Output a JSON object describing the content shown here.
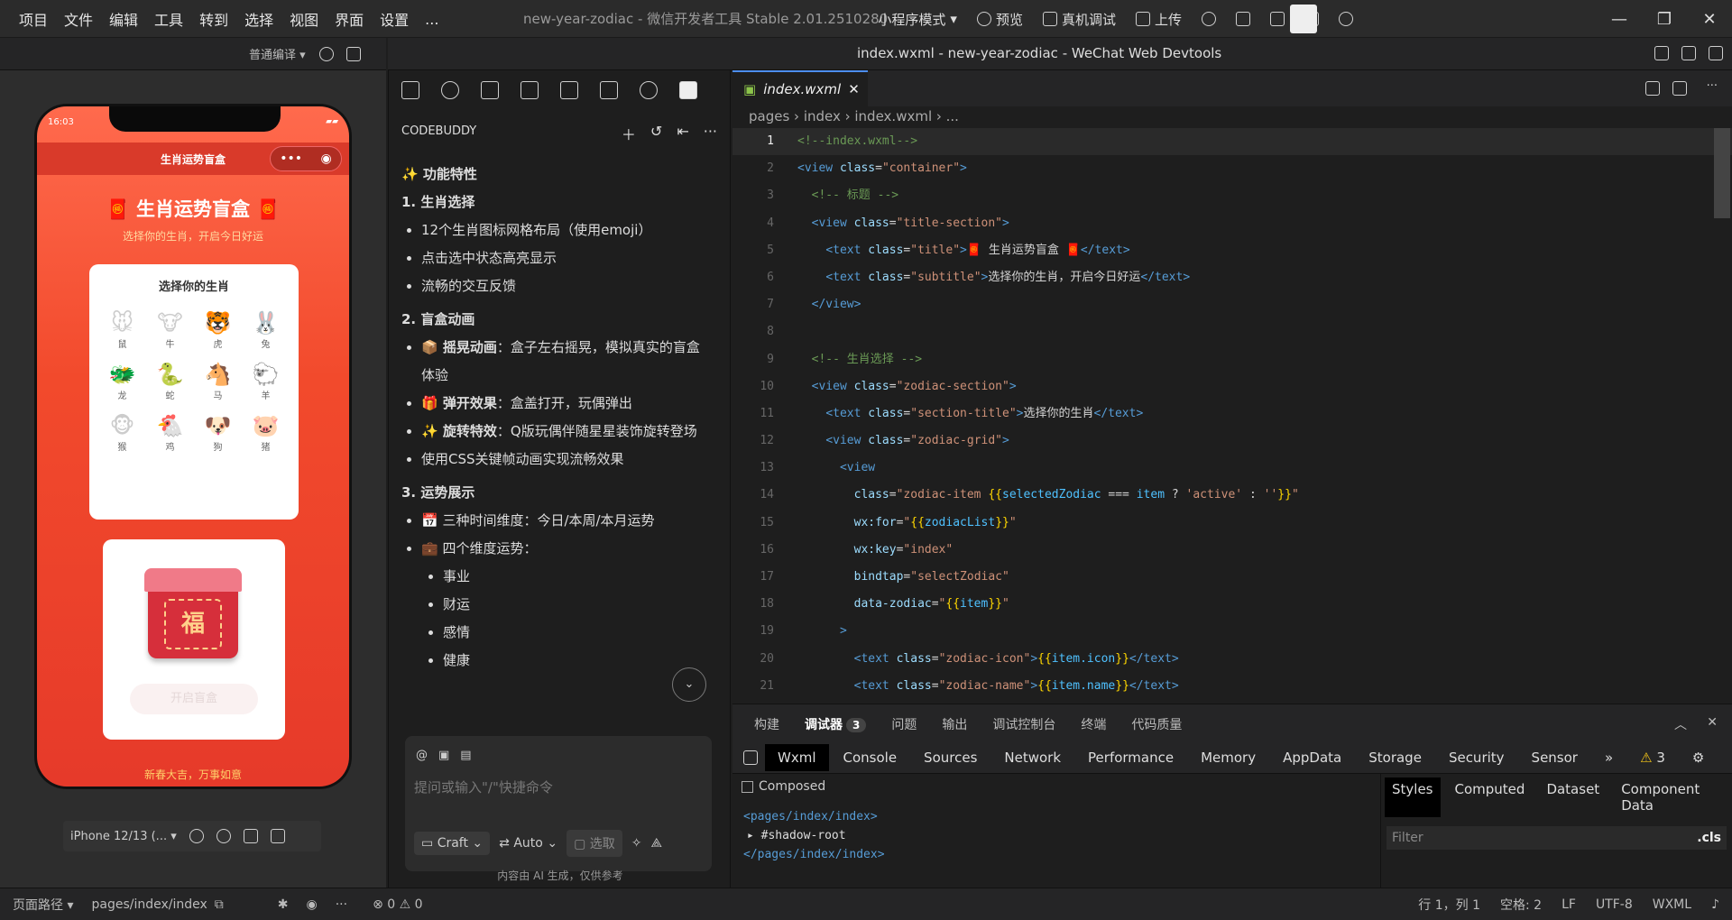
{
  "menu": [
    "项目",
    "文件",
    "编辑",
    "工具",
    "转到",
    "选择",
    "视图",
    "界面",
    "设置",
    "..."
  ],
  "app_title": "new-year-zodiac - 微信开发者工具 Stable 2.01.2510280",
  "toolbar": {
    "mode": "小程序模式",
    "preview": "预览",
    "realdebug": "真机调试",
    "upload": "上传"
  },
  "compile_mode": "普通编译",
  "editor_window_title": "index.wxml - new-year-zodiac - WeChat Web Devtools",
  "phone": {
    "time": "16:03",
    "nav_title": "生肖运势盲盒",
    "big_title": "🧧 生肖运势盲盒 🧧",
    "subtitle": "选择你的生肖，开启今日好运",
    "card_title": "选择你的生肖",
    "zodiac": [
      {
        "icon": "🐭",
        "name": "鼠"
      },
      {
        "icon": "🐮",
        "name": "牛"
      },
      {
        "icon": "🐯",
        "name": "虎"
      },
      {
        "icon": "🐰",
        "name": "兔"
      },
      {
        "icon": "🐲",
        "name": "龙"
      },
      {
        "icon": "🐍",
        "name": "蛇"
      },
      {
        "icon": "🐴",
        "name": "马"
      },
      {
        "icon": "🐑",
        "name": "羊"
      },
      {
        "icon": "🐵",
        "name": "猴"
      },
      {
        "icon": "🐔",
        "name": "鸡"
      },
      {
        "icon": "🐶",
        "name": "狗"
      },
      {
        "icon": "🐷",
        "name": "猪"
      }
    ],
    "box_char": "福",
    "open_button": "开启盲盒",
    "footer": "新春大吉，万事如意"
  },
  "device_select": "iPhone 12/13 (...",
  "codebuddy": {
    "header": "CODEBUDDY",
    "features_title": "✨ 功能特性",
    "s1": "1. 生肖选择",
    "s1_items": [
      "12个生肖图标网格布局（使用emoji）",
      "点击选中状态高亮显示",
      "流畅的交互反馈"
    ],
    "s2": "2. 盲盒动画",
    "s2_items": [
      {
        "b": "📦 摇晃动画",
        "t": "：盒子左右摇晃，模拟真实的盲盒体验"
      },
      {
        "b": "🎁 弹开效果",
        "t": "：盒盖打开，玩偶弹出"
      },
      {
        "b": "✨ 旋转特效",
        "t": "：Q版玩偶伴随星星装饰旋转登场"
      }
    ],
    "s2_last": "使用CSS关键帧动画实现流畅效果",
    "s3": "3. 运势展示",
    "s3_items": [
      "📅 三种时间维度：今日/本周/本月运势",
      "💼 四个维度运势："
    ],
    "s3_sub": [
      "事业",
      "财运",
      "感情",
      "健康"
    ],
    "chat_placeholder": "提问或输入\"/\"快捷命令",
    "craft": "Craft",
    "auto": "Auto",
    "select": "选取",
    "disclaimer": "内容由 AI 生成，仅供参考"
  },
  "editor": {
    "tab": "index.wxml",
    "breadcrumb": "pages › index › index.wxml › ..."
  },
  "devtools": {
    "tabs": [
      "构建",
      "调试器",
      "问题",
      "输出",
      "调试控制台",
      "终端",
      "代码质量"
    ],
    "debugger_badge": "3",
    "panel_tabs": [
      "Wxml",
      "Console",
      "Sources",
      "Network",
      "Performance",
      "Memory",
      "AppData",
      "Storage",
      "Security",
      "Sensor"
    ],
    "warn_count": "3",
    "composed": "Composed",
    "dom": [
      "<pages/index/index>",
      "#shadow-root",
      "</pages/index/index>"
    ],
    "style_tabs": [
      "Styles",
      "Computed",
      "Dataset",
      "Component Data"
    ],
    "filter": "Filter",
    "cls": ".cls"
  },
  "status": {
    "path_label": "页面路径",
    "path": "pages/index/index",
    "errors": "⊗ 0 ⚠ 0",
    "position": "行 1，列 1",
    "spaces": "空格: 2",
    "eol": "LF",
    "encoding": "UTF-8",
    "lang": "WXML"
  }
}
